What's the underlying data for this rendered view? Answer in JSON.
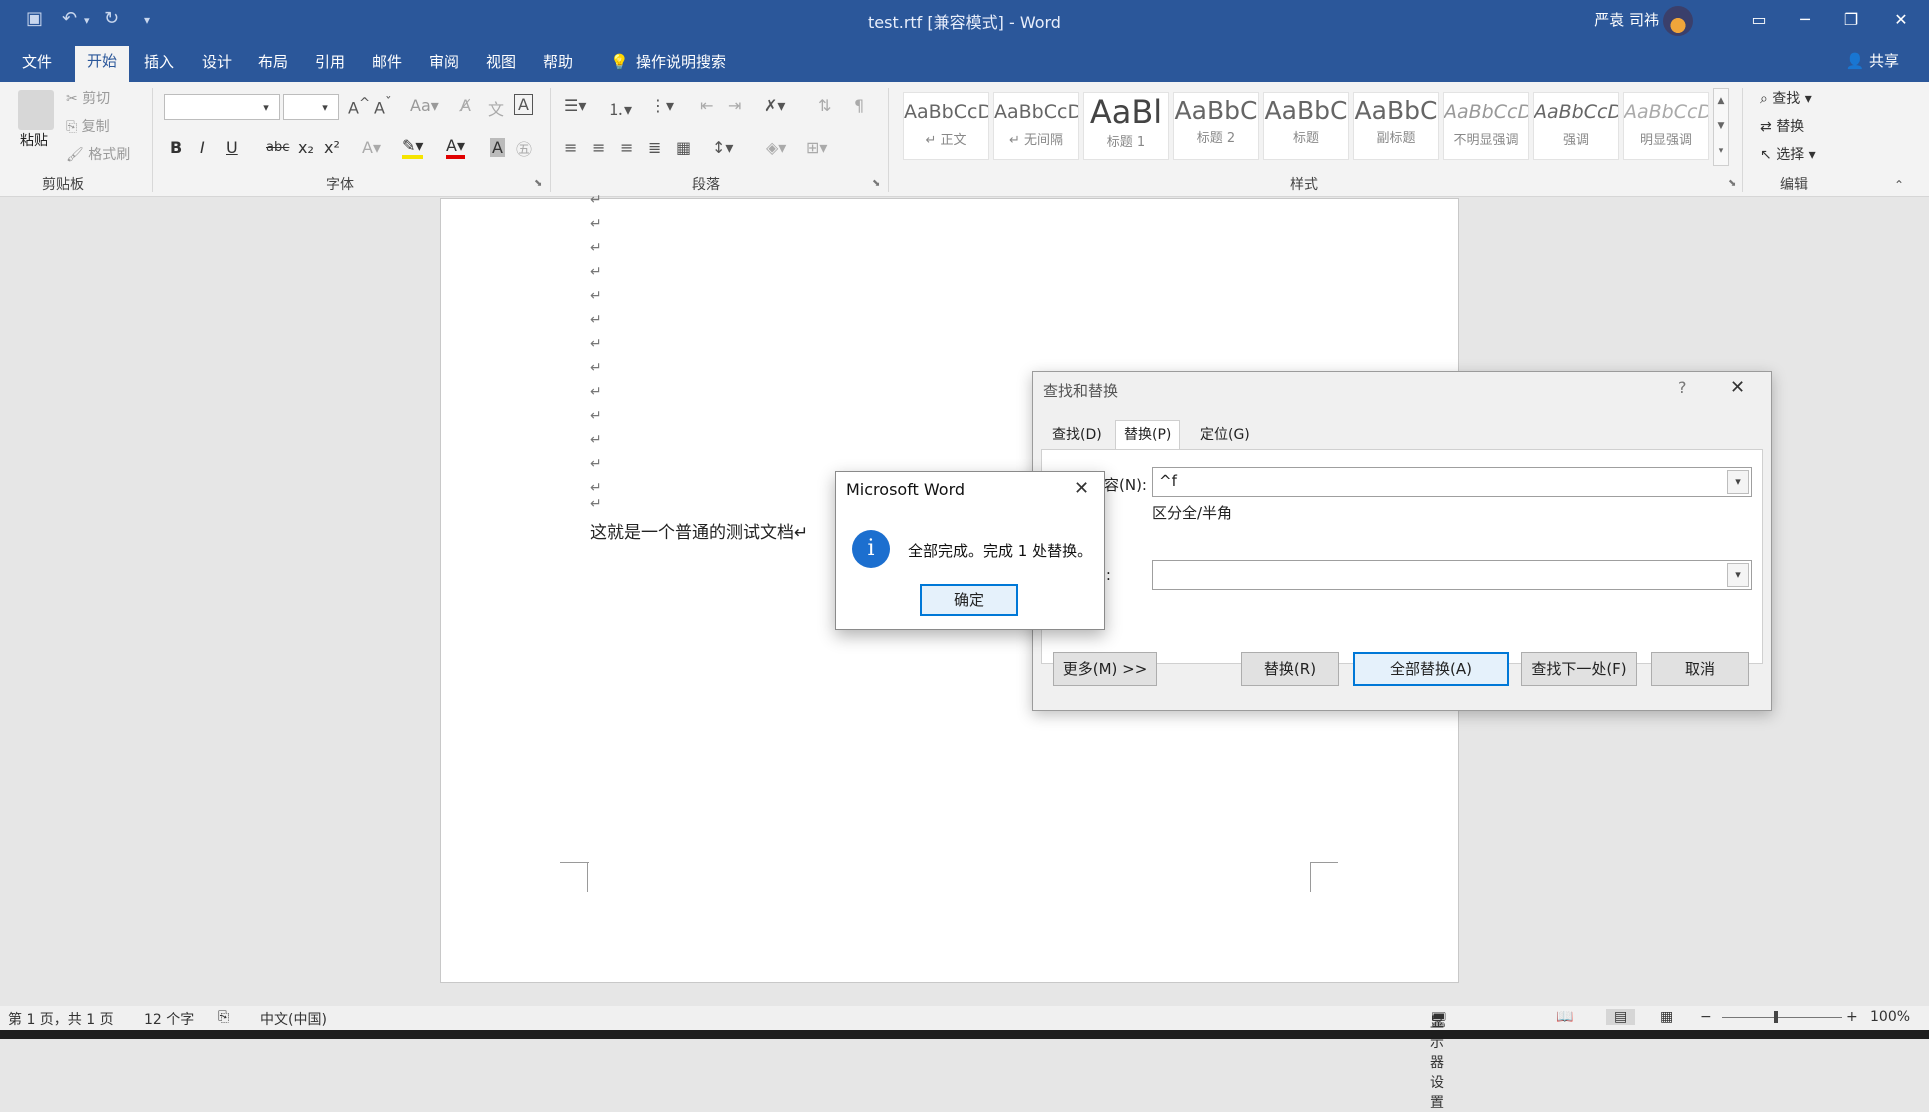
{
  "titlebar": {
    "title": "test.rtf [兼容模式]  -  Word",
    "user": "严袁 司祎",
    "share": "共享"
  },
  "tabs": [
    "文件",
    "开始",
    "插入",
    "设计",
    "布局",
    "引用",
    "邮件",
    "审阅",
    "视图",
    "帮助"
  ],
  "tell_me": "操作说明搜索",
  "ribbon": {
    "clipboard": {
      "paste": "粘贴",
      "cut": "剪切",
      "copy": "复制",
      "format_painter": "格式刷",
      "label": "剪贴板"
    },
    "font": {
      "label": "字体",
      "bold": "B",
      "italic": "I",
      "underline": "U",
      "strike": "abc",
      "sub": "x₂",
      "sup": "x²"
    },
    "paragraph": {
      "label": "段落"
    },
    "styles": {
      "label": "样式",
      "items": [
        {
          "sample": "AaBbCcDc",
          "name": "↵ 正文"
        },
        {
          "sample": "AaBbCcDc",
          "name": "↵ 无间隔"
        },
        {
          "sample": "AaBl",
          "name": "标题 1"
        },
        {
          "sample": "AaBbC",
          "name": "标题 2"
        },
        {
          "sample": "AaBbC",
          "name": "标题"
        },
        {
          "sample": "AaBbC",
          "name": "副标题"
        },
        {
          "sample": "AaBbCcDı",
          "name": "不明显强调"
        },
        {
          "sample": "AaBbCcDı",
          "name": "强调"
        },
        {
          "sample": "AaBbCcDı",
          "name": "明显强调"
        }
      ]
    },
    "editing": {
      "find": "查找",
      "replace": "替换",
      "select": "选择",
      "label": "编辑"
    }
  },
  "document": {
    "body_text": "这就是一个普通的测试文档↵",
    "para_mark": "↵"
  },
  "statusbar": {
    "page": "第 1 页，共 1 页",
    "words": "12 个字",
    "language": "中文(中国)",
    "display": "显示器设置",
    "zoom": "100%"
  },
  "find_replace": {
    "title": "查找和替换",
    "help": "?",
    "tabs": [
      "查找(D)",
      "替换(P)",
      "定位(G)"
    ],
    "find_label": "容(N):",
    "find_value": "^f",
    "option_text": "区分全/半角",
    "replace_label": "):",
    "replace_value": "",
    "buttons": {
      "more": "更多(M) >>",
      "replace": "替换(R)",
      "replace_all": "全部替换(A)",
      "find_next": "查找下一处(F)",
      "cancel": "取消"
    }
  },
  "message_box": {
    "title": "Microsoft Word",
    "icon": "i",
    "text": "全部完成。完成 1 处替换。",
    "ok": "确定"
  },
  "colors": {
    "brand": "#2b579a",
    "accent": "#0078d7"
  }
}
